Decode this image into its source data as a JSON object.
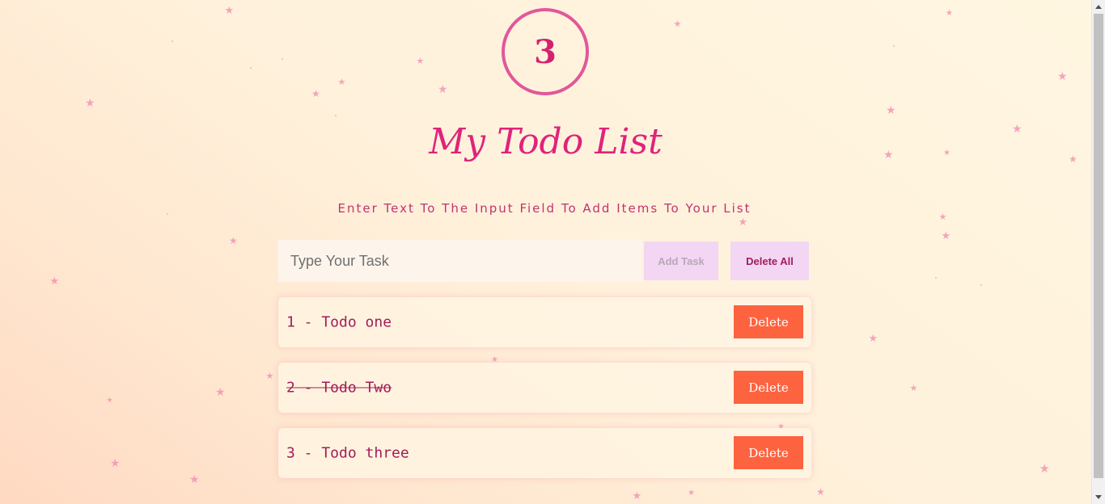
{
  "counter": "3",
  "title": "My Todo List",
  "subtitle": "Enter Text To The Input Field To Add Items To Your List",
  "input": {
    "placeholder": "Type Your Task",
    "value": ""
  },
  "buttons": {
    "add": "Add Task",
    "delete_all": "Delete All"
  },
  "todos": [
    {
      "text": "1 - Todo one",
      "completed": false,
      "delete_label": "Delete"
    },
    {
      "text": "2 - Todo Two",
      "completed": true,
      "delete_label": "Delete"
    },
    {
      "text": "3 - Todo three",
      "completed": false,
      "delete_label": "Delete"
    }
  ],
  "colors": {
    "accent": "#e0237a",
    "text": "#a11d59",
    "delete_button": "#fe6340",
    "secondary_button": "#f3d6f3",
    "star": "#f08ab0"
  },
  "icons": [
    "star-icon"
  ]
}
